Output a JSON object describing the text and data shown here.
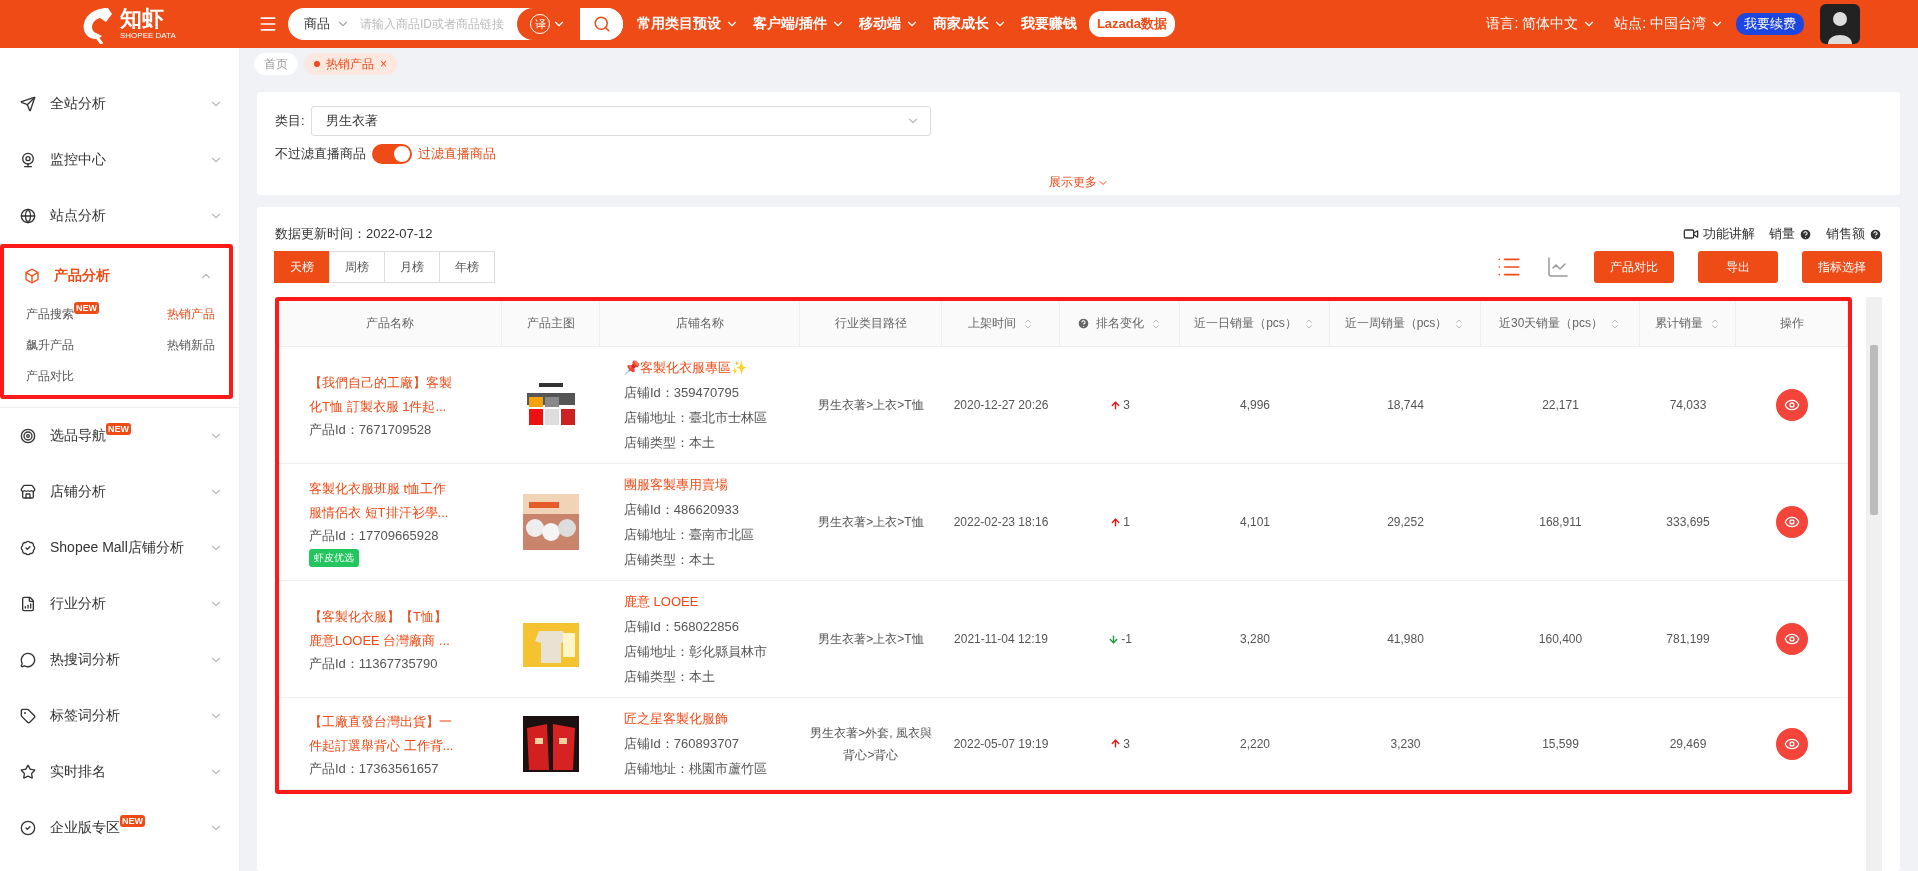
{
  "topbar": {
    "logo": {
      "name": "知虾",
      "sub": "SHOPEE DATA"
    },
    "search": {
      "scope": "商品",
      "placeholder": "请输入商品ID或者商品链接",
      "translate": "译"
    },
    "nav": [
      {
        "label": "常用类目预设",
        "kind": "menu"
      },
      {
        "label": "客户端/插件",
        "kind": "menu"
      },
      {
        "label": "移动端",
        "kind": "menu"
      },
      {
        "label": "商家成长",
        "kind": "menu"
      },
      {
        "label": "我要赚钱",
        "kind": "link"
      },
      {
        "label": "Lazada数据",
        "kind": "pill"
      }
    ],
    "language": "语言: 简体中文",
    "site": "站点: 中国台湾",
    "renew": "我要续费"
  },
  "tabs": [
    {
      "label": "首页",
      "selected": false
    },
    {
      "label": "热销产品",
      "selected": true,
      "close": "×"
    }
  ],
  "sidebar": {
    "items": [
      {
        "label": "全站分析",
        "expanded": false
      },
      {
        "label": "监控中心",
        "expanded": false
      },
      {
        "label": "站点分析",
        "expanded": false
      },
      {
        "label": "产品分析",
        "expanded": true,
        "children": [
          {
            "label": "产品搜索",
            "badge": "NEW",
            "selected": false
          },
          {
            "label": "热销产品",
            "selected": true
          },
          {
            "label": "飙升产品",
            "selected": false
          },
          {
            "label": "热销新品",
            "selected": false
          },
          {
            "label": "产品对比",
            "selected": false
          }
        ]
      },
      {
        "label": "选品导航",
        "expanded": false,
        "badge": "NEW"
      },
      {
        "label": "店铺分析",
        "expanded": false
      },
      {
        "label": "Shopee Mall店铺分析",
        "expanded": false
      },
      {
        "label": "行业分析",
        "expanded": false
      },
      {
        "label": "热搜词分析",
        "expanded": false
      },
      {
        "label": "标签词分析",
        "expanded": false
      },
      {
        "label": "实时排名",
        "expanded": false
      },
      {
        "label": "企业版专区",
        "expanded": false,
        "badge": "NEW"
      }
    ]
  },
  "filter": {
    "category_label": "类目:",
    "category_value": "男生衣著",
    "live_off_label": "不过滤直播商品",
    "live_filter_on": true,
    "live_on_label": "过滤直播商品",
    "more": "展示更多"
  },
  "ranking": {
    "updated": "数据更新时间：2022-07-12",
    "periods": [
      {
        "label": "天榜",
        "selected": true
      },
      {
        "label": "周榜",
        "selected": false
      },
      {
        "label": "月榜",
        "selected": false
      },
      {
        "label": "年榜",
        "selected": false
      }
    ],
    "links": [
      {
        "label": "功能讲解",
        "kind": "video"
      },
      {
        "label": "销量",
        "kind": "help"
      },
      {
        "label": "销售额",
        "kind": "help"
      }
    ],
    "views": [
      {
        "kind": "list",
        "selected": true
      },
      {
        "kind": "chart",
        "selected": false
      }
    ],
    "buttons": [
      "产品对比",
      "导出",
      "指标选择"
    ]
  },
  "table": {
    "columns": [
      {
        "label": "产品名称",
        "sortable": false,
        "help": false
      },
      {
        "label": "产品主图",
        "sortable": false,
        "help": false
      },
      {
        "label": "店铺名称",
        "sortable": false,
        "help": false
      },
      {
        "label": "行业类目路径",
        "sortable": false,
        "help": false
      },
      {
        "label": "上架时间",
        "sortable": true,
        "help": false
      },
      {
        "label": "排名变化",
        "sortable": true,
        "help": true
      },
      {
        "label": "近一日销量（pcs）",
        "sortable": true,
        "help": false
      },
      {
        "label": "近一周销量（pcs）",
        "sortable": true,
        "help": false
      },
      {
        "label": "近30天销量（pcs）",
        "sortable": true,
        "help": false
      },
      {
        "label": "累计销量",
        "sortable": true,
        "help": false
      },
      {
        "label": "操作",
        "sortable": false,
        "help": false
      }
    ],
    "rows": [
      {
        "name": "【我們自己的工廠】客製化T恤 訂製衣服 1件起...",
        "product_id": "产品Id：7671709528",
        "shop": {
          "name": "📌客製化衣服專區✨",
          "lines": [
            "店铺Id：359470795",
            "店铺地址：臺北市士林區",
            "店铺类型：本土"
          ]
        },
        "category": "男生衣著>上衣>T恤",
        "listed": "2020-12-27 20:26",
        "rank": {
          "kind": "up",
          "value": "3"
        },
        "day": "4,996",
        "week": "18,744",
        "month": "22,171",
        "total": "74,033"
      },
      {
        "name": "客製化衣服班服 t恤工作服情侶衣 短T排汗衫學...",
        "product_id": "产品Id：17709665928",
        "badge": "虾皮优选",
        "shop": {
          "name": "團服客製專用賣場",
          "lines": [
            "店铺Id：486620933",
            "店铺地址：臺南市北區",
            "店铺类型：本土"
          ]
        },
        "category": "男生衣著>上衣>T恤",
        "listed": "2022-02-23 18:16",
        "rank": {
          "kind": "up",
          "value": "1"
        },
        "day": "4,101",
        "week": "29,252",
        "month": "168,911",
        "total": "333,695"
      },
      {
        "name": "【客製化衣服】【T恤】鹿意LOOEE 台灣廠商 ...",
        "product_id": "产品Id：11367735790",
        "shop": {
          "name": "鹿意 LOOEE",
          "lines": [
            "店铺Id：568022856",
            "店铺地址：彰化縣員林市",
            "店铺类型：本土"
          ]
        },
        "category": "男生衣著>上衣>T恤",
        "listed": "2021-11-04 12:19",
        "rank": {
          "kind": "down",
          "value": "-1"
        },
        "day": "3,280",
        "week": "41,980",
        "month": "160,400",
        "total": "781,199"
      },
      {
        "name": "【工廠直發台灣出貨】一件起訂選舉背心 工作背...",
        "product_id": "产品Id：17363561657",
        "shop": {
          "name": "匠之星客製化服飾",
          "lines": [
            "店铺Id：760893707",
            "店铺地址：桃園市蘆竹區"
          ]
        },
        "category": "男生衣著>外套, 風衣與背心>背心",
        "listed": "2022-05-07 19:19",
        "rank": {
          "kind": "up",
          "value": "3"
        },
        "day": "2,220",
        "week": "3,230",
        "month": "15,599",
        "total": "29,469"
      }
    ]
  }
}
